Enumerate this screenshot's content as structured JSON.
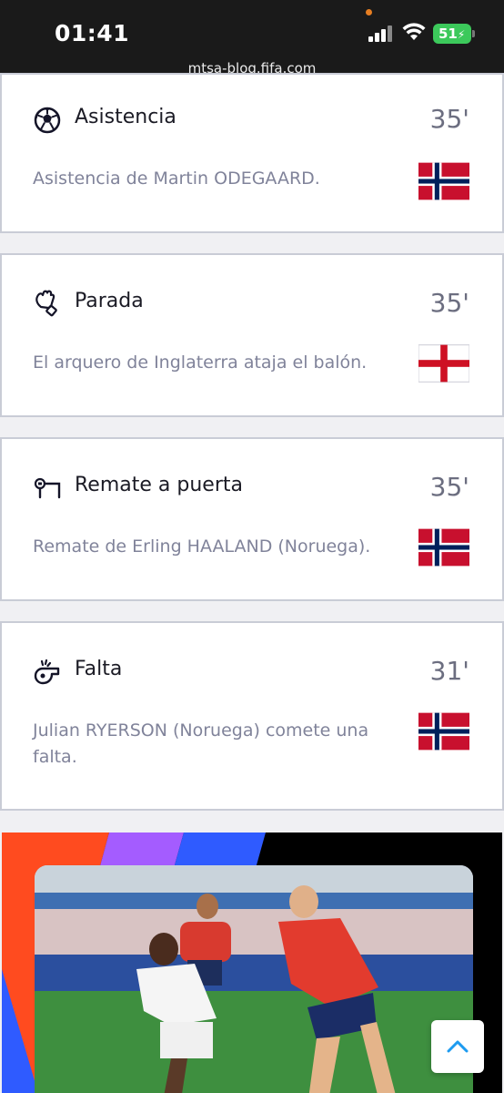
{
  "status_bar": {
    "time": "01:41",
    "battery": "51",
    "url": "mtsa-blog.fifa.com"
  },
  "events": [
    {
      "icon": "soccer-ball-icon",
      "title": "Asistencia",
      "minute": "35'",
      "description": "Asistencia de Martin ODEGAARD.",
      "flag": "norway-flag-icon"
    },
    {
      "icon": "goalkeeper-glove-icon",
      "title": "Parada",
      "minute": "35'",
      "description": "El arquero de Inglaterra ataja el balón.",
      "flag": "england-flag-icon"
    },
    {
      "icon": "shot-on-goal-icon",
      "title": "Remate a puerta",
      "minute": "35'",
      "description": "Remate de Erling HAALAND (Noruega).",
      "flag": "norway-flag-icon"
    },
    {
      "icon": "whistle-icon",
      "title": "Falta",
      "minute": "31'",
      "description": "Julian RYERSON (Noruega) comete una falta.",
      "flag": "norway-flag-icon"
    }
  ],
  "colors": {
    "norway_red": "#c8102e",
    "norway_blue": "#00205b",
    "england_red": "#ce1124",
    "accent_blue": "#1d9bf0"
  },
  "media": {
    "icon": "match-photo"
  },
  "scroll_top": {
    "icon": "chevron-up-icon"
  }
}
